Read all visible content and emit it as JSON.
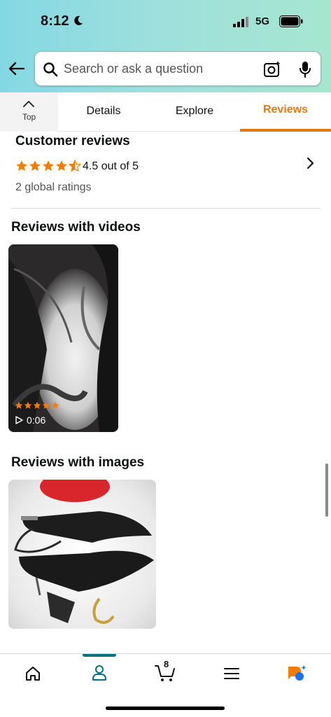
{
  "status_bar": {
    "time": "8:12",
    "network": "5G"
  },
  "search": {
    "placeholder": "Search or ask a question"
  },
  "tabs": {
    "top": "Top",
    "details": "Details",
    "explore": "Explore",
    "reviews": "Reviews",
    "active": "reviews"
  },
  "reviews": {
    "heading": "Customer reviews",
    "rating": 4.5,
    "rating_text": "4.5 out of 5",
    "global_ratings": "2 global ratings"
  },
  "videos_section": {
    "heading": "Reviews with videos",
    "video": {
      "rating": 5,
      "duration": "0:06"
    }
  },
  "images_section": {
    "heading": "Reviews with images"
  },
  "nav": {
    "cart_count": "8",
    "active": "account"
  },
  "colors": {
    "accent": "#e47911",
    "star": "#f57c00",
    "nav_active": "#007185",
    "header_gradient_start": "#84d8e3",
    "header_gradient_end": "#a6e6cf"
  }
}
